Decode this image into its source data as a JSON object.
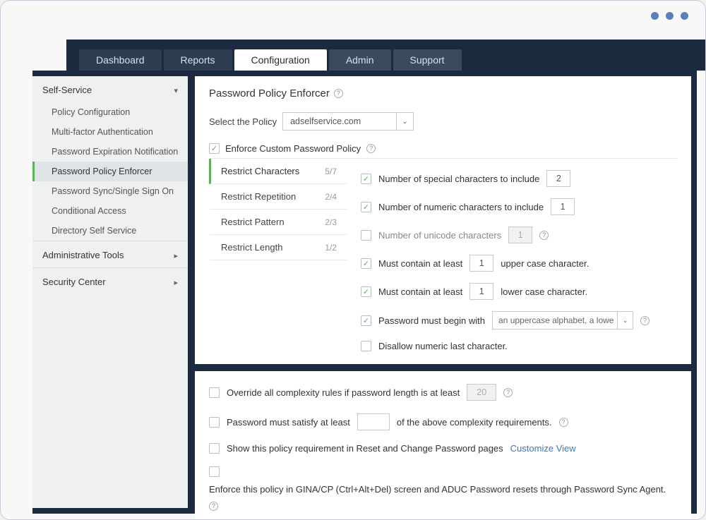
{
  "tabs": [
    "Dashboard",
    "Reports",
    "Configuration",
    "Admin",
    "Support"
  ],
  "sidebar": {
    "group1": {
      "title": "Self-Service",
      "items": [
        "Policy Configuration",
        "Multi-factor Authentication",
        "Password Expiration Notification",
        "Password Policy Enforcer",
        "Password Sync/Single Sign On",
        "Conditional Access",
        "Directory Self Service"
      ]
    },
    "group2": {
      "title": "Administrative Tools"
    },
    "group3": {
      "title": "Security Center"
    }
  },
  "page": {
    "title": "Password Policy Enforcer",
    "select_label": "Select the Policy",
    "selected_policy": "adselfservice.com",
    "enforce_label": "Enforce Custom Password Policy"
  },
  "rule_tabs": [
    {
      "label": "Restrict Characters",
      "count": "5/7"
    },
    {
      "label": "Restrict Repetition",
      "count": "2/4"
    },
    {
      "label": "Restrict Pattern",
      "count": "2/3"
    },
    {
      "label": "Restrict Length",
      "count": "1/2"
    }
  ],
  "rules": {
    "r1": {
      "label": "Number of special characters to include",
      "value": "2"
    },
    "r2": {
      "label": "Number of numeric characters to include",
      "value": "1"
    },
    "r3": {
      "label": "Number of unicode characters",
      "value": "1"
    },
    "r4_pre": "Must contain at least",
    "r4_val": "1",
    "r4_post": "upper case character.",
    "r5_pre": "Must contain at least",
    "r5_val": "1",
    "r5_post": "lower case character.",
    "r6_label": "Password must begin with",
    "r6_sel": "an uppercase alphabet, a lowe",
    "r7": "Disallow numeric last character."
  },
  "panel2": {
    "p1_pre": "Override all complexity rules if password length is at least",
    "p1_val": "20",
    "p2_pre": "Password must satisfy at least",
    "p2_post": "of the above complexity requirements.",
    "p3_pre": "Show this policy requirement in Reset and Change Password pages",
    "p3_link": "Customize View",
    "p4": "Enforce this policy in GINA/CP (Ctrl+Alt+Del) screen and ADUC Password resets through Password Sync Agent."
  }
}
